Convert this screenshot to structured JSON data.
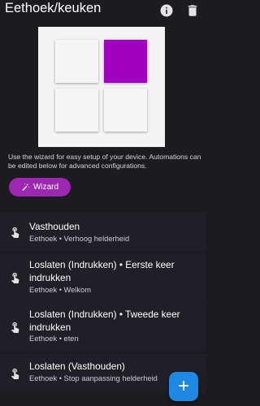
{
  "header": {
    "title": "Eethoek/keuken",
    "info_icon": "info-icon",
    "delete_icon": "trash-icon"
  },
  "device_preview": {
    "tiles": [
      {
        "color": "#f5f5f5"
      },
      {
        "color": "#a000c0"
      },
      {
        "color": "#f5f5f5"
      },
      {
        "color": "#f5f5f5"
      }
    ]
  },
  "wizard": {
    "description": "Use the wizard for easy setup of your device. Automations can be edited below for advanced configurations.",
    "button_label": "Wizard",
    "button_icon": "magic-wand-icon",
    "button_color": "#9c27b0"
  },
  "automations": [
    {
      "name": "Vasthouden",
      "detail": "Eethoek • Verhoog helderheid",
      "icon": "touch-icon"
    },
    {
      "name": "Loslaten (Indrukken) • Eerste keer indrukken",
      "detail": "Eethoek • Welkom",
      "icon": "touch-icon"
    },
    {
      "name": "Loslaten (Indrukken) • Tweede keer indrukken",
      "detail": "Eethoek • eten",
      "icon": "touch-icon"
    },
    {
      "name": "Loslaten (Vasthouden)",
      "detail": "Eethoek • Stop aanpassing helderheid",
      "icon": "touch-icon"
    }
  ],
  "fab": {
    "label": "+",
    "color": "#1e88e5"
  }
}
